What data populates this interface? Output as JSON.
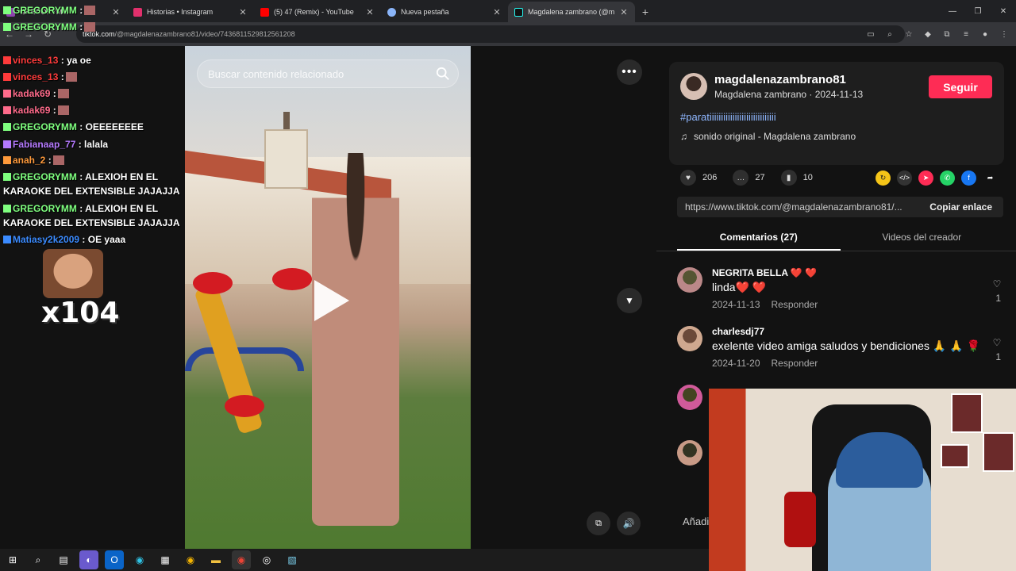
{
  "tabs": [
    {
      "label": "GREGORYMM :",
      "favicon_color": "#8e44ad",
      "favicon": "twitch-icon"
    },
    {
      "label": "Historias • Instagram",
      "favicon_color": "#e1306c",
      "favicon": "instagram-icon"
    },
    {
      "label": "(5) 47 (Remix) - YouTube",
      "favicon_color": "#ff0000",
      "favicon": "youtube-icon"
    },
    {
      "label": "Nueva pestaña",
      "favicon_color": "#8ab4f8",
      "favicon": "chrome-icon"
    },
    {
      "label": "Magdalena zambrano (@magd",
      "favicon_color": "#111111",
      "favicon": "tiktok-icon"
    }
  ],
  "url": {
    "domain": "tiktok.com",
    "path": "/@magdalenazambrano81/video/7436811529812561208"
  },
  "video": {
    "search_placeholder": "Buscar contenido relacionado"
  },
  "author": {
    "username": "magdalenazambrano81",
    "subtitle": "Magdalena zambrano · 2024-11-13",
    "follow_label": "Seguir",
    "hashtag": "#paratiiiiiiiiiiiiiiiiiiiiiiiiiiiii",
    "sound": "sonido original - Magdalena zambrano"
  },
  "stats": {
    "likes": "206",
    "comments": "27",
    "saves": "10"
  },
  "share_link": {
    "url": "https://www.tiktok.com/@magdalenazambrano81/...",
    "copy_label": "Copiar enlace"
  },
  "panel_tabs": {
    "comments": "Comentarios (27)",
    "creator_videos": "Videos del creador"
  },
  "comments": [
    {
      "user": "NEGRITA BELLA ❤️ ❤️",
      "text": "linda❤️ ❤️",
      "date": "2024-11-13",
      "reply": "Responder",
      "likes": "1"
    },
    {
      "user": "charlesdj77",
      "text": "exelente video amiga saludos y bendiciones 🙏 🙏 🌹",
      "date": "2024-11-20",
      "reply": "Responder",
      "likes": "1"
    }
  ],
  "add_comment": "Añadir",
  "chat": [
    {
      "user": "GREGORYMM",
      "msg": ":",
      "color": "#7fff7f",
      "emote": true
    },
    {
      "user": "GREGORYMM",
      "msg": ":",
      "color": "#7fff7f",
      "emote": true
    },
    {
      "user": "vinces_13",
      "msg": ": ya oe",
      "color": "#ff3b3b",
      "emote": false
    },
    {
      "user": "vinces_13",
      "msg": ":",
      "color": "#ff3b3b",
      "emote": true
    },
    {
      "user": "kadak69",
      "msg": ":",
      "color": "#ff6b8b",
      "emote": true
    },
    {
      "user": "kadak69",
      "msg": ":",
      "color": "#ff6b8b",
      "emote": true
    },
    {
      "user": "GREGORYMM",
      "msg": ": OEEEEEEEE",
      "color": "#7fff7f",
      "emote": false
    },
    {
      "user": "Fabianaap_77",
      "msg": ": lalala",
      "color": "#b57aff",
      "emote": false
    },
    {
      "user": "anah_2",
      "msg": ":",
      "color": "#ff9a3b",
      "emote": true
    },
    {
      "user": "GREGORYMM",
      "msg": ": ALEXIOH EN EL KARAOKE DEL EXTENSIBLE JAJAJJA",
      "color": "#7fff7f",
      "emote": false
    },
    {
      "user": "GREGORYMM",
      "msg": ": ALEXIOH EN EL KARAOKE DEL EXTENSIBLE JAJAJJA",
      "color": "#7fff7f",
      "emote": false
    },
    {
      "user": "Matiasy2k2009",
      "msg": ": OE yaaa",
      "color": "#3b8bff",
      "emote": false
    }
  ],
  "emote_multiplier": "x104"
}
